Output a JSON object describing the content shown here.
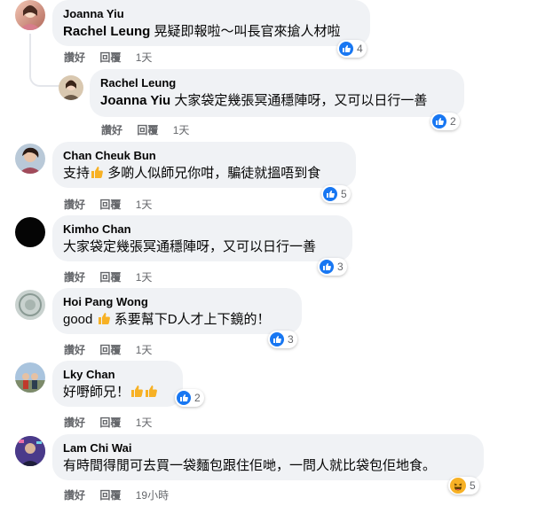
{
  "actions": {
    "like": "讚好",
    "reply": "回覆"
  },
  "comments": [
    {
      "author": "Joanna Yiu",
      "mention": "Rachel Leung",
      "text": "晃疑即報啦～叫長官來搶人材啦",
      "time": "1天",
      "reactions": "4",
      "reaction_type": "like"
    },
    {
      "author": "Rachel Leung",
      "mention": "Joanna Yiu",
      "text": "大家袋定幾張冥通穩陣呀，又可以日行一善",
      "time": "1天",
      "reactions": "2",
      "reaction_type": "like"
    },
    {
      "author": "Chan Cheuk Bun",
      "text_a": "支持",
      "text_b": "多啲人似師兄你咁，騙徒就搵唔到食",
      "time": "1天",
      "reactions": "5",
      "reaction_type": "like"
    },
    {
      "author": "Kimho Chan",
      "text": "大家袋定幾張冥通穩陣呀，又可以日行一善",
      "time": "1天",
      "reactions": "3",
      "reaction_type": "like"
    },
    {
      "author": "Hoi Pang Wong",
      "text_a": "good",
      "text_b": "系要幫下D人才上下鏡的！",
      "time": "1天",
      "reactions": "3",
      "reaction_type": "like"
    },
    {
      "author": "Lky Chan",
      "text": "好嘢師兄！",
      "time": "1天",
      "reactions": "2",
      "reaction_type": "like"
    },
    {
      "author": "Lam Chi Wai",
      "text": "有時間得閒可去買一袋麵包跟住佢哋，一問人就比袋包佢地食。",
      "time": "19小時",
      "reactions": "5",
      "reaction_type": "haha"
    }
  ],
  "colors": {
    "bubble": "#f0f2f5",
    "like_blue": "#1877f2",
    "meta_grey": "#65676b",
    "thumb_yellow": "#f7b125"
  }
}
